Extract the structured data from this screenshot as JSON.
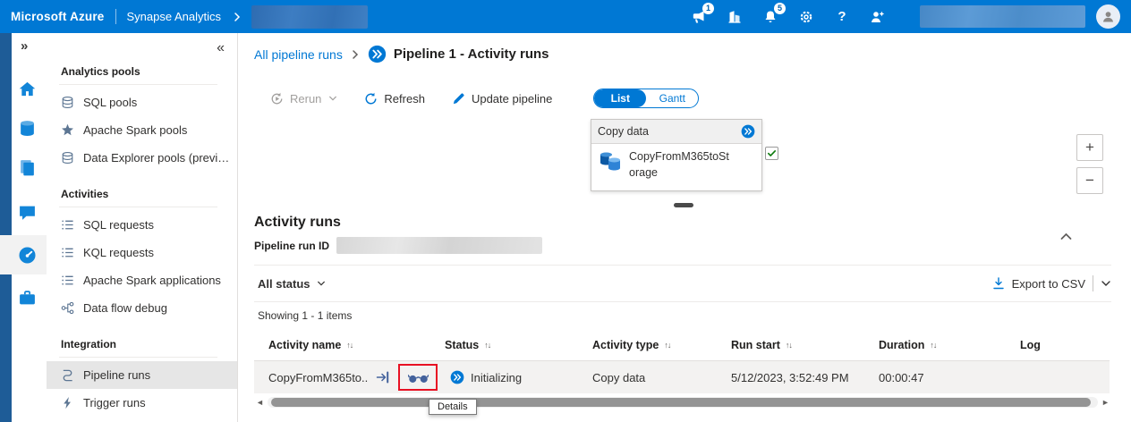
{
  "topbar": {
    "brand": "Microsoft Azure",
    "product": "Synapse Analytics",
    "alert_badge": "1",
    "bell_badge": "5",
    "help_glyph": "?"
  },
  "icons": {
    "rail_expand": "»",
    "sidebar_collapse": "«",
    "sort": "↑↓",
    "zoom_in": "+",
    "zoom_out": "−",
    "scroll_left": "◄",
    "scroll_right": "►"
  },
  "sidebar": {
    "selected": "Pipeline runs",
    "sections": [
      {
        "title": "Analytics pools",
        "items": [
          {
            "label": "SQL pools"
          },
          {
            "label": "Apache Spark pools"
          },
          {
            "label": "Data Explorer pools (preview)"
          }
        ]
      },
      {
        "title": "Activities",
        "items": [
          {
            "label": "SQL requests"
          },
          {
            "label": "KQL requests"
          },
          {
            "label": "Apache Spark applications"
          },
          {
            "label": "Data flow debug"
          }
        ]
      },
      {
        "title": "Integration",
        "items": [
          {
            "label": "Pipeline runs"
          },
          {
            "label": "Trigger runs"
          }
        ]
      }
    ]
  },
  "breadcrumb": {
    "parent": "All pipeline runs",
    "current": "Pipeline 1 - Activity runs"
  },
  "toolbar": {
    "rerun": "Rerun",
    "refresh": "Refresh",
    "update_pipeline": "Update pipeline",
    "list": "List",
    "gantt": "Gantt",
    "selected_view": "List"
  },
  "canvas": {
    "node_header": "Copy data",
    "node_label": "CopyFromM365toStorage"
  },
  "activity": {
    "title": "Activity runs",
    "run_id_label": "Pipeline run ID",
    "status_filter": "All status",
    "export": "Export to CSV",
    "showing": "Showing 1 - 1 items",
    "columns": [
      "Activity name",
      "Status",
      "Activity type",
      "Run start",
      "Duration",
      "Log"
    ],
    "row": {
      "name": "CopyFromM365to...",
      "status": "Initializing",
      "type": "Copy data",
      "start": "5/12/2023, 3:52:49 PM",
      "duration": "00:00:47",
      "log": ""
    },
    "tooltip": "Details"
  },
  "colors": {
    "topbar": "#0078d4",
    "accent": "#0078d4",
    "annotation": "#e81123",
    "row_bg": "#f3f2f1"
  }
}
